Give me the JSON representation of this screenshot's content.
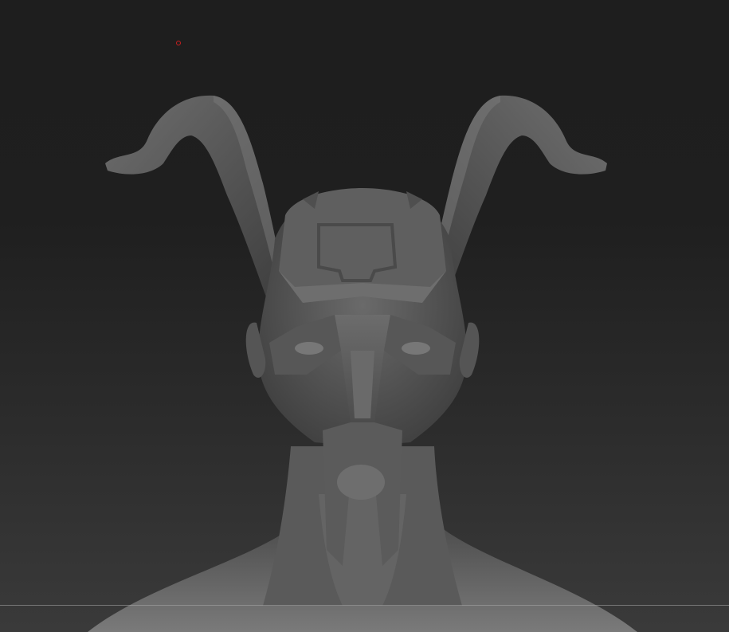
{
  "canvas": {
    "background_top": "#1e1e1e",
    "background_bottom": "#3a3a3a",
    "model_color": "#5e5e5e",
    "cursor_color": "#c81e1e"
  },
  "model": {
    "subject": "horned-helmet-sculpt"
  }
}
